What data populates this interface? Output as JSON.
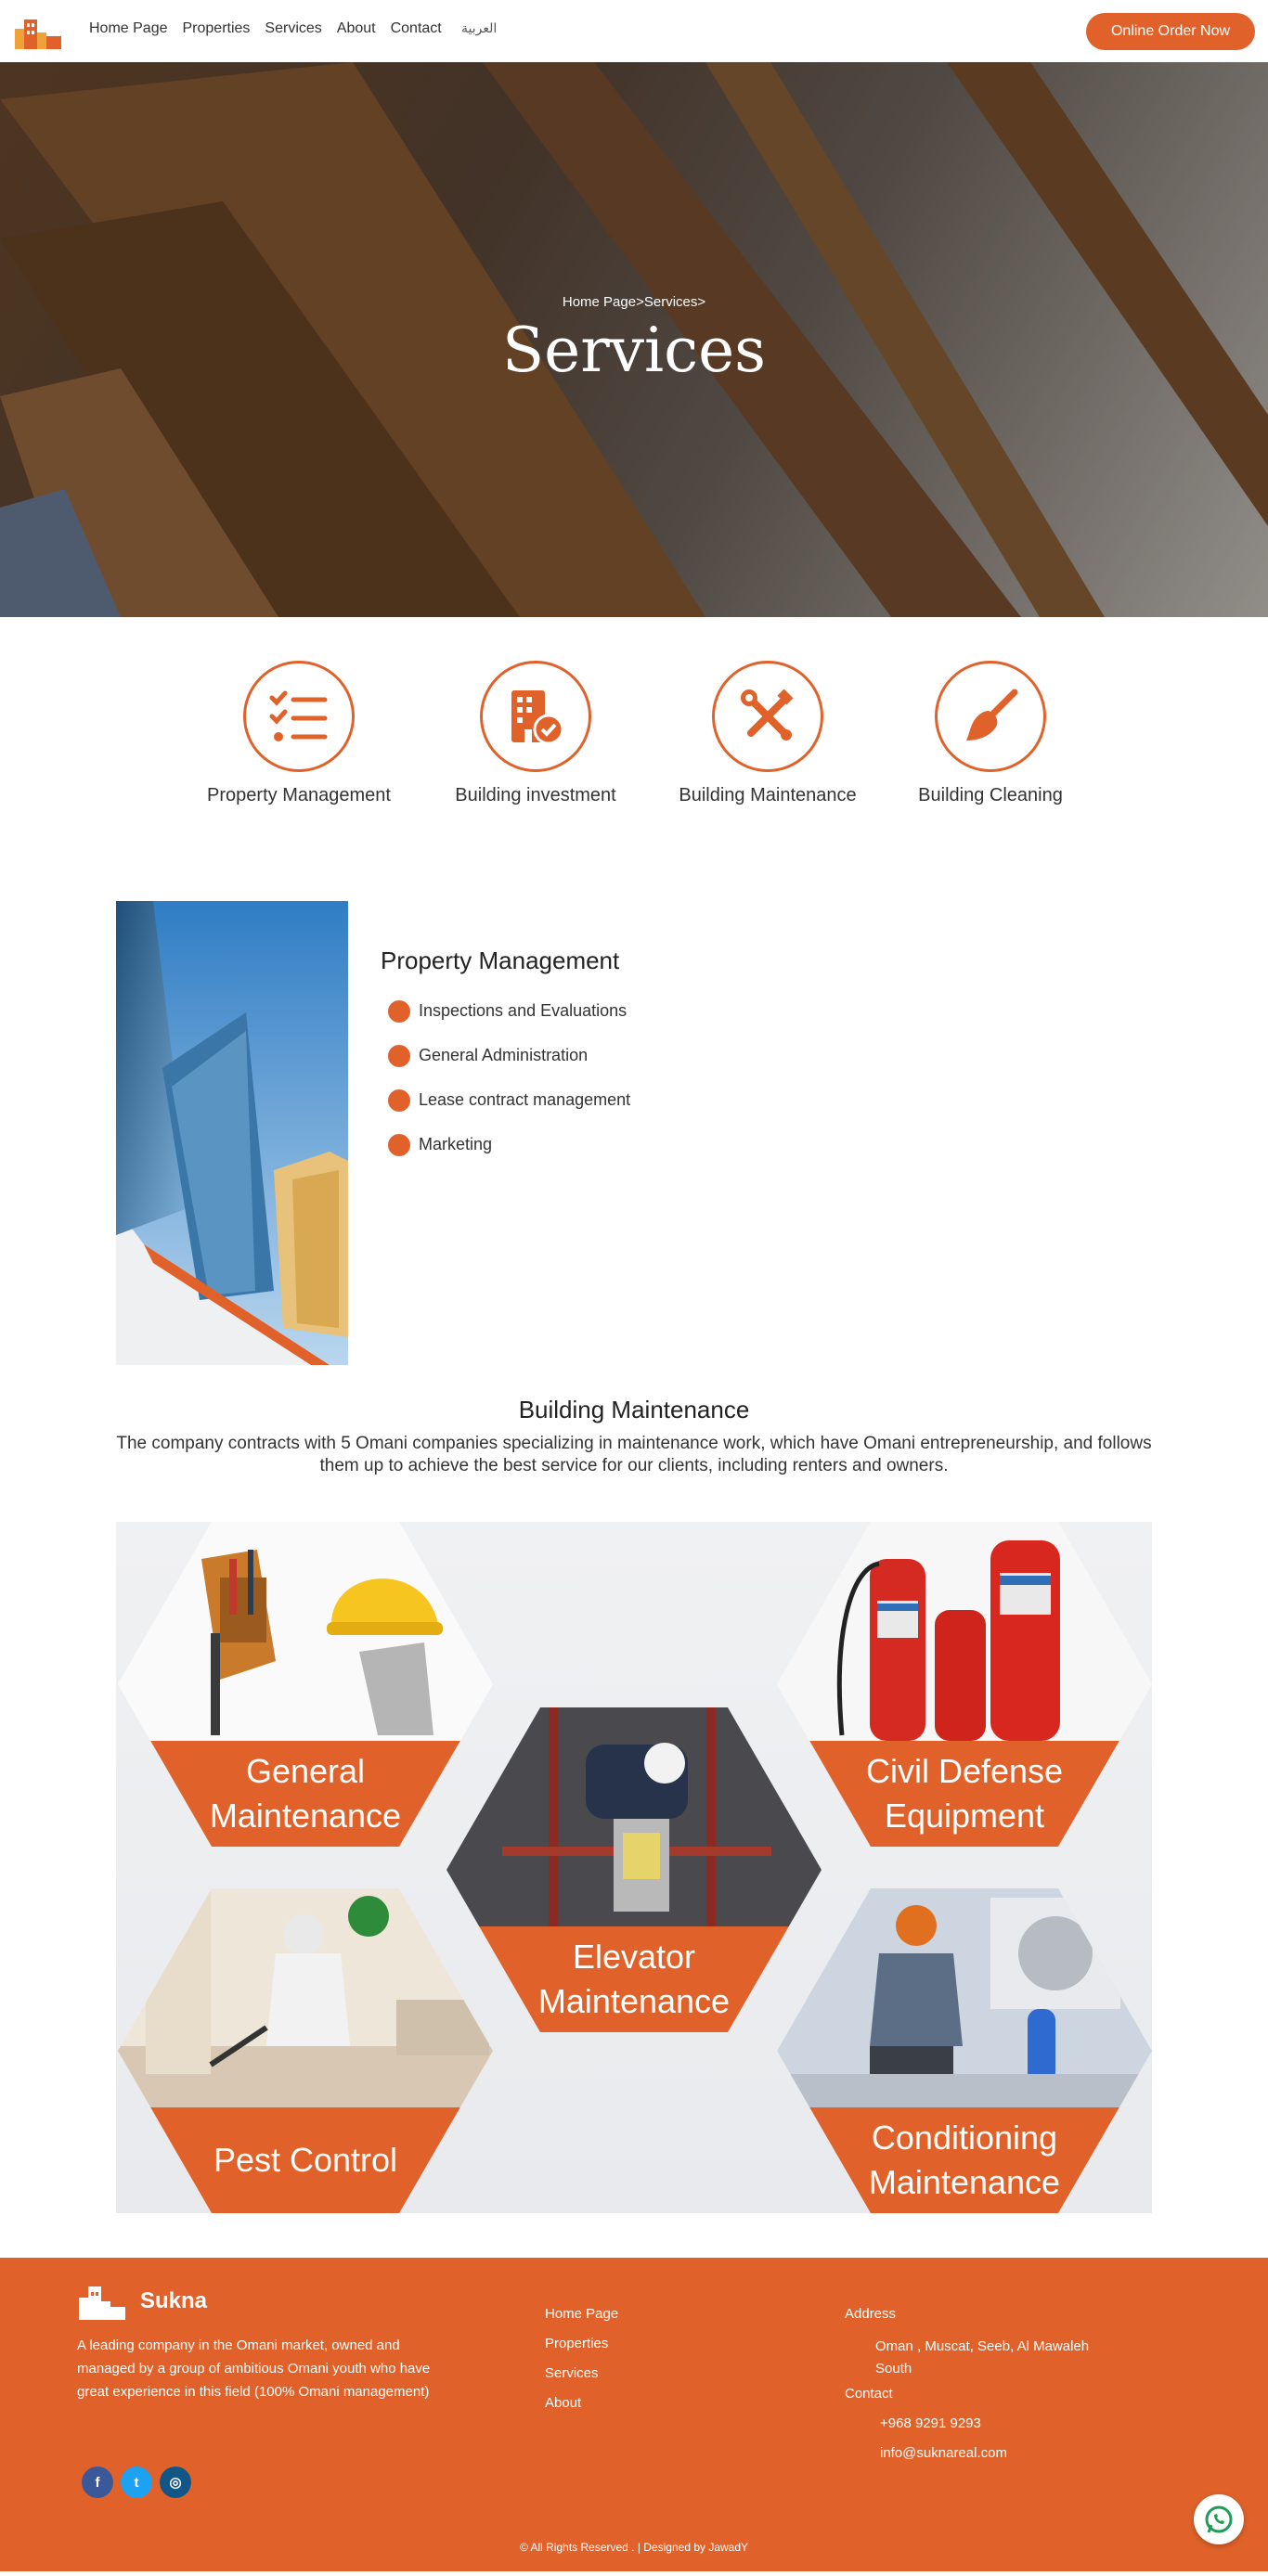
{
  "nav": {
    "links": [
      "Home Page",
      "Properties",
      "Services",
      "About",
      "Contact"
    ],
    "language": "العربية",
    "cta": "Online Order Now"
  },
  "hero": {
    "breadcrumb": "Home Page>Services>",
    "title": "Services"
  },
  "services": [
    {
      "label": "Property Management",
      "icon": "checklist-icon"
    },
    {
      "label": "Building investment",
      "icon": "building-check-icon"
    },
    {
      "label": "Building Maintenance",
      "icon": "wrench-screwdriver-icon"
    },
    {
      "label": "Building Cleaning",
      "icon": "broom-icon"
    }
  ],
  "property_management": {
    "title": "Property Management",
    "items": [
      "Inspections and Evaluations",
      "General Administration",
      "Lease contract management",
      "Marketing"
    ]
  },
  "building_maintenance": {
    "title": "Building Maintenance",
    "description": "The company contracts with 5 Omani companies specializing in maintenance work, which have Omani entrepreneurship, and follows them up to achieve the best service for our clients, including renters and owners.",
    "tiles": [
      {
        "line1": "General",
        "line2": "Maintenance"
      },
      {
        "line1": "Civil Defense",
        "line2": "Equipment"
      },
      {
        "line1": "Elevator",
        "line2": "Maintenance"
      },
      {
        "line1": "Pest Control",
        "line2": ""
      },
      {
        "line1": "Conditioning",
        "line2": "Maintenance"
      }
    ]
  },
  "footer": {
    "brand": "Sukna",
    "about": "A leading company in the Omani market, owned and managed by a group of ambitious Omani youth who have great experience in this field (100% Omani management)",
    "links": [
      "Home Page",
      "Properties",
      "Services",
      "About"
    ],
    "address_label": "Address",
    "address": "Oman , Muscat, Seeb, Al Mawaleh South",
    "contact_label": "Contact",
    "phone": "+968 9291 9293",
    "email": "info@suknareal.com",
    "copyright": "© All Rights Reserved . | Designed by JawadY",
    "social": [
      {
        "icon": "facebook-icon",
        "glyph": "f",
        "color": "#3b5998"
      },
      {
        "icon": "twitter-icon",
        "glyph": "t",
        "color": "#1da1f2"
      },
      {
        "icon": "instagram-icon",
        "glyph": "◎",
        "color": "#125688"
      }
    ]
  },
  "colors": {
    "accent": "#e0622a"
  }
}
